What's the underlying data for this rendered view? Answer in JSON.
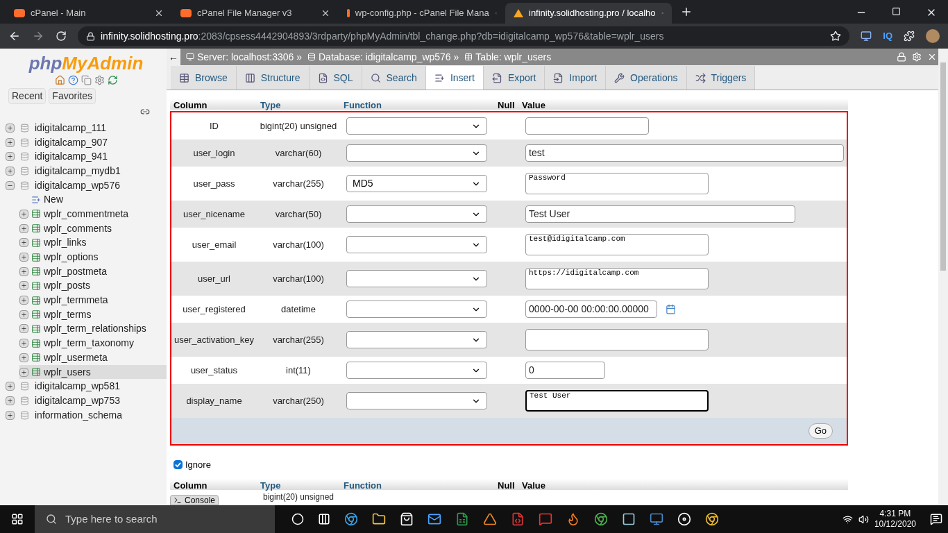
{
  "browser": {
    "tabs": [
      {
        "title": "cPanel - Main",
        "selected": false
      },
      {
        "title": "cPanel File Manager v3",
        "selected": false
      },
      {
        "title": "wp-config.php - cPanel File Mana",
        "selected": false
      },
      {
        "title": "infinity.solidhosting.pro / localho",
        "selected": true
      }
    ],
    "url_host": "infinity.solidhosting.pro",
    "url_path": ":2083/cpsess4442904893/3rdparty/phpMyAdmin/tbl_change.php?db=idigitalcamp_wp576&table=wplr_users",
    "extension_label": "IQ"
  },
  "sidebar": {
    "logo_left": "php",
    "logo_right": "MyAdmin",
    "buttons": [
      "Recent",
      "Favorites"
    ],
    "tree": [
      {
        "label": "idigitalcamp_111",
        "expanded": false,
        "selected": false
      },
      {
        "label": "idigitalcamp_907",
        "expanded": false,
        "selected": false
      },
      {
        "label": "idigitalcamp_941",
        "expanded": false,
        "selected": false
      },
      {
        "label": "idigitalcamp_mydb1",
        "expanded": false,
        "selected": false
      },
      {
        "label": "idigitalcamp_wp576",
        "expanded": true,
        "selected": false,
        "children": [
          {
            "label": "New",
            "kind": "new",
            "selected": false
          },
          {
            "label": "wplr_commentmeta",
            "kind": "table",
            "selected": false
          },
          {
            "label": "wplr_comments",
            "kind": "table",
            "selected": false
          },
          {
            "label": "wplr_links",
            "kind": "table",
            "selected": false
          },
          {
            "label": "wplr_options",
            "kind": "table",
            "selected": false
          },
          {
            "label": "wplr_postmeta",
            "kind": "table",
            "selected": false
          },
          {
            "label": "wplr_posts",
            "kind": "table",
            "selected": false
          },
          {
            "label": "wplr_termmeta",
            "kind": "table",
            "selected": false
          },
          {
            "label": "wplr_terms",
            "kind": "table",
            "selected": false
          },
          {
            "label": "wplr_term_relationships",
            "kind": "table",
            "selected": false
          },
          {
            "label": "wplr_term_taxonomy",
            "kind": "table",
            "selected": false
          },
          {
            "label": "wplr_usermeta",
            "kind": "table",
            "selected": false
          },
          {
            "label": "wplr_users",
            "kind": "table",
            "selected": true
          }
        ]
      },
      {
        "label": "idigitalcamp_wp581",
        "expanded": false,
        "selected": false
      },
      {
        "label": "idigitalcamp_wp753",
        "expanded": false,
        "selected": false
      },
      {
        "label": "information_schema",
        "expanded": false,
        "selected": false
      }
    ]
  },
  "back_label": "←",
  "breadcrumb": [
    {
      "kind": "server",
      "label": "Server: localhost:3306 »"
    },
    {
      "kind": "database",
      "label": "Database: idigitalcamp_wp576 »"
    },
    {
      "kind": "table",
      "label": "Table: wplr_users"
    }
  ],
  "tabs": [
    {
      "label": "Browse",
      "selected": false
    },
    {
      "label": "Structure",
      "selected": false
    },
    {
      "label": "SQL",
      "selected": false
    },
    {
      "label": "Search",
      "selected": false
    },
    {
      "label": "Insert",
      "selected": true
    },
    {
      "label": "Export",
      "selected": false
    },
    {
      "label": "Import",
      "selected": false
    },
    {
      "label": "Operations",
      "selected": false
    },
    {
      "label": "Triggers",
      "selected": false
    }
  ],
  "table": {
    "columns": [
      "Column",
      "Type",
      "Function",
      "Null",
      "Value"
    ],
    "rows": [
      {
        "column": "ID",
        "type": "bigint(20) unsigned",
        "function": "",
        "kind": "short",
        "value": "",
        "focused": false
      },
      {
        "column": "user_login",
        "type": "varchar(60)",
        "function": "",
        "kind": "wide",
        "value": "test",
        "focused": false
      },
      {
        "column": "user_pass",
        "type": "varchar(255)",
        "function": "MD5",
        "kind": "textarea",
        "value": "Password",
        "focused": false
      },
      {
        "column": "user_nicename",
        "type": "varchar(50)",
        "function": "",
        "kind": "medium",
        "value": "Test User",
        "focused": false
      },
      {
        "column": "user_email",
        "type": "varchar(100)",
        "function": "",
        "kind": "textarea",
        "value": "test@idigitalcamp.com",
        "focused": false
      },
      {
        "column": "user_url",
        "type": "varchar(100)",
        "function": "",
        "kind": "textarea",
        "value": "https://idigitalcamp.com",
        "focused": false
      },
      {
        "column": "user_registered",
        "type": "datetime",
        "function": "",
        "kind": "date",
        "value": "0000-00-00 00:00:00.00000",
        "focused": false
      },
      {
        "column": "user_activation_key",
        "type": "varchar(255)",
        "function": "",
        "kind": "textarea",
        "value": "",
        "focused": false
      },
      {
        "column": "user_status",
        "type": "int(11)",
        "function": "",
        "kind": "small",
        "value": "0",
        "focused": false
      },
      {
        "column": "display_name",
        "type": "varchar(250)",
        "function": "",
        "kind": "textarea",
        "value": "Test User",
        "focused": true
      }
    ],
    "go_button": "Go"
  },
  "ignore": {
    "label": "Ignore",
    "checked": true
  },
  "second_table": {
    "columns": [
      "Column",
      "Type",
      "Function",
      "Null",
      "Value"
    ],
    "first_row_type": "bigint(20) unsigned"
  },
  "console_button": "Console",
  "taskbar": {
    "search_placeholder": "Type here to search",
    "time": "4:31 PM",
    "date": "10/12/2020"
  }
}
